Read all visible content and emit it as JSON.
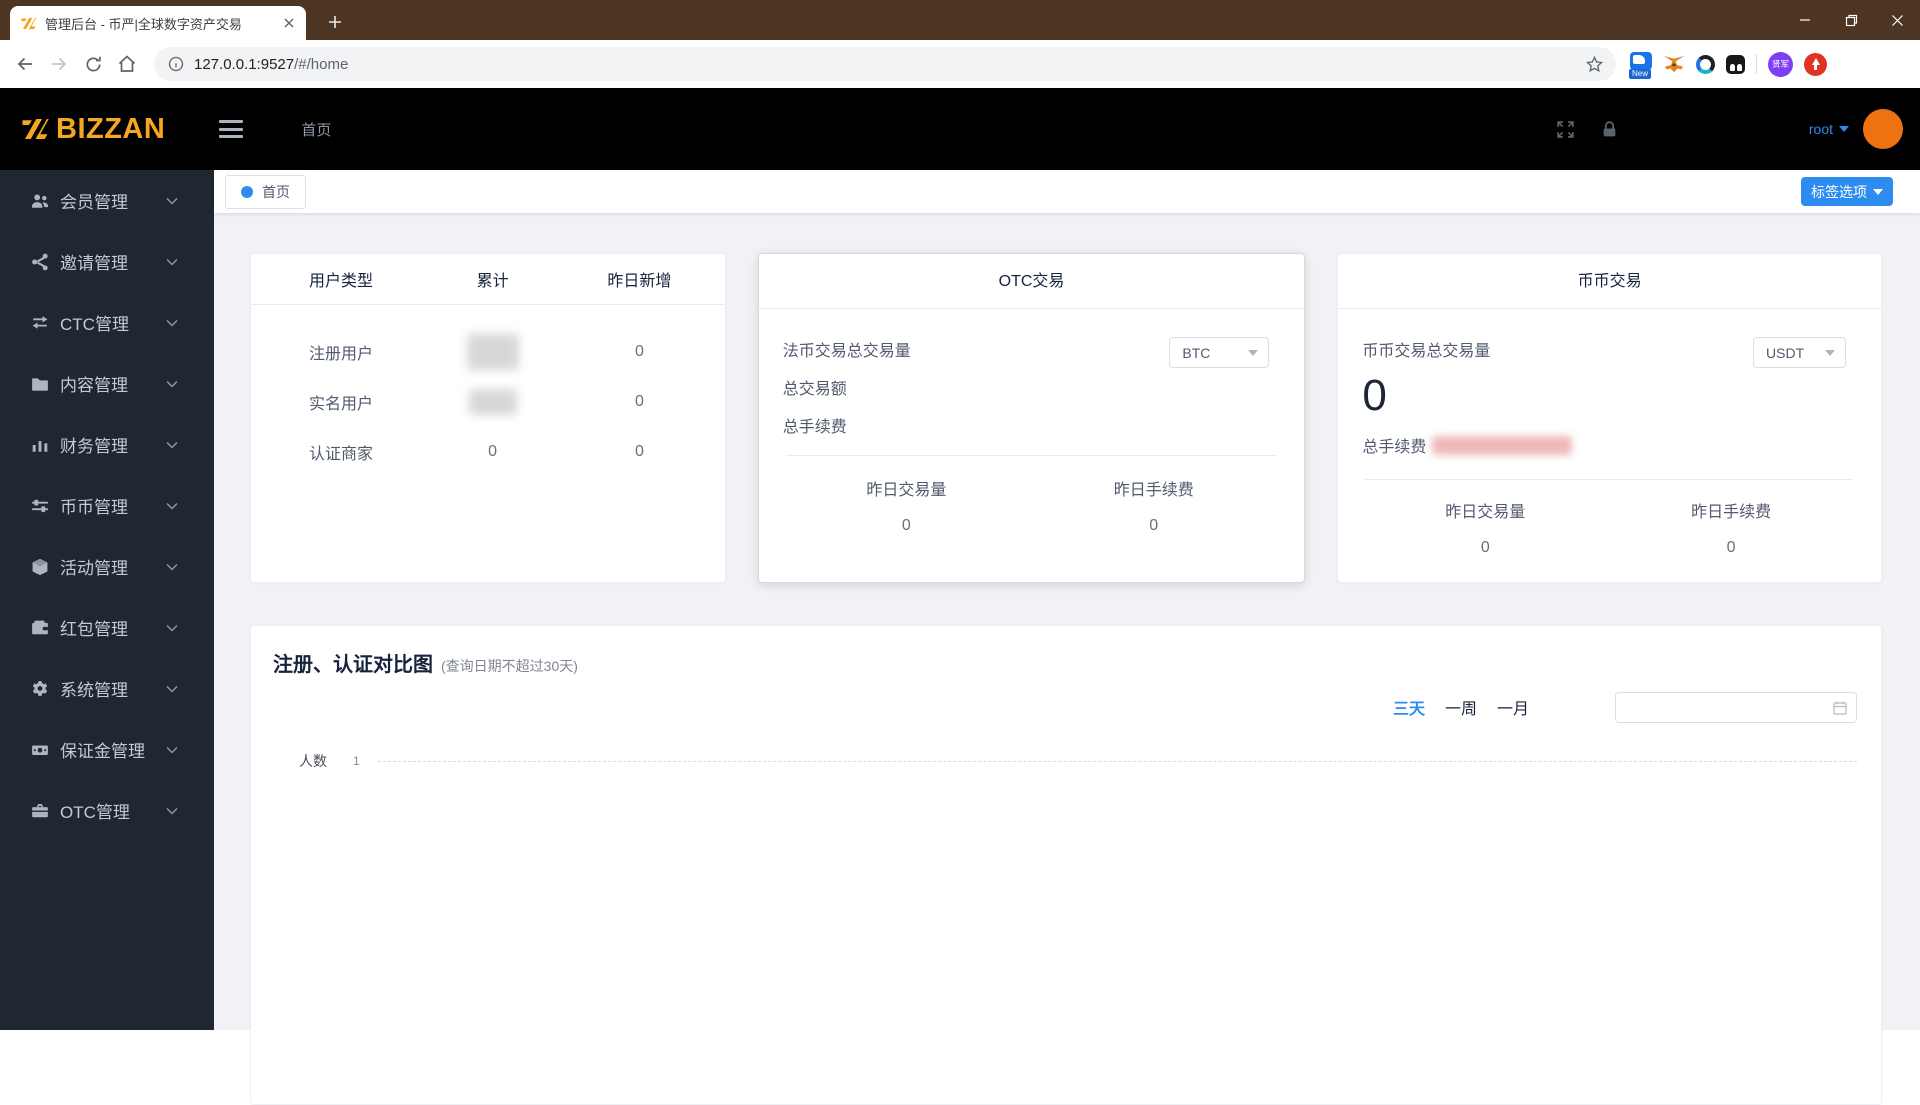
{
  "browser": {
    "tab": {
      "title": "管理后台 - 币严|全球数字资产交易"
    },
    "url": {
      "host": "127.0.0.1:9527",
      "path": "/#/home"
    },
    "extensions": {
      "new_badge": "New",
      "purple_badge": "贤军"
    }
  },
  "header": {
    "brand": "BIZZAN",
    "nav_home": "首页",
    "username": "root"
  },
  "sidebar": {
    "items": [
      {
        "label": "会员管理",
        "icon": "users-icon"
      },
      {
        "label": "邀请管理",
        "icon": "share-icon"
      },
      {
        "label": "CTC管理",
        "icon": "swap-icon"
      },
      {
        "label": "内容管理",
        "icon": "folder-icon"
      },
      {
        "label": "财务管理",
        "icon": "bar-chart-icon"
      },
      {
        "label": "币币管理",
        "icon": "sliders-icon"
      },
      {
        "label": "活动管理",
        "icon": "cube-icon"
      },
      {
        "label": "红包管理",
        "icon": "wallet-icon"
      },
      {
        "label": "系统管理",
        "icon": "gear-icon"
      },
      {
        "label": "保证金管理",
        "icon": "banknote-icon"
      },
      {
        "label": "OTC管理",
        "icon": "briefcase-icon"
      }
    ]
  },
  "tagbar": {
    "home_tag": "首页",
    "options_button": "标签选项"
  },
  "stats_card": {
    "headers": [
      "用户类型",
      "累计",
      "昨日新增"
    ],
    "rows": [
      {
        "label": "注册用户",
        "total": "",
        "total_redacted": true,
        "yesterday": "0"
      },
      {
        "label": "实名用户",
        "total": "",
        "total_redacted": true,
        "yesterday": "0"
      },
      {
        "label": "认证商家",
        "total": "0",
        "total_redacted": false,
        "yesterday": "0"
      }
    ]
  },
  "otc_card": {
    "title": "OTC交易",
    "volume_label": "法币交易总交易量",
    "currency": "BTC",
    "amount_label": "总交易额",
    "fee_label": "总手续费",
    "yesterday_volume_label": "昨日交易量",
    "yesterday_volume": "0",
    "yesterday_fee_label": "昨日手续费",
    "yesterday_fee": "0"
  },
  "spot_card": {
    "title": "币币交易",
    "volume_label": "币币交易总交易量",
    "currency": "USDT",
    "total_volume": "0",
    "fee_label": "总手续费",
    "fee_value_redacted": true,
    "yesterday_volume_label": "昨日交易量",
    "yesterday_volume": "0",
    "yesterday_fee_label": "昨日手续费",
    "yesterday_fee": "0"
  },
  "chart": {
    "title": "注册、认证对比图",
    "subtitle": "(查询日期不超过30天)",
    "ranges": [
      "三天",
      "一周",
      "一月"
    ],
    "active_range": "三天",
    "y_axis_name": "人数",
    "y_tick": "1",
    "date_input_value": ""
  },
  "chart_data": {
    "type": "line",
    "title": "注册、认证对比图",
    "ylabel": "人数",
    "y_ticks": [
      1
    ],
    "x": [],
    "series": []
  },
  "colors": {
    "accent_blue": "#2d8cf0",
    "brand_orange": "#f5a623",
    "titlebar_brown": "#4d3523",
    "header_bg": "#000000",
    "sidebar_bg": "#1f2733",
    "content_bg": "#f0f2f5",
    "avatar_orange": "#ee7211"
  }
}
